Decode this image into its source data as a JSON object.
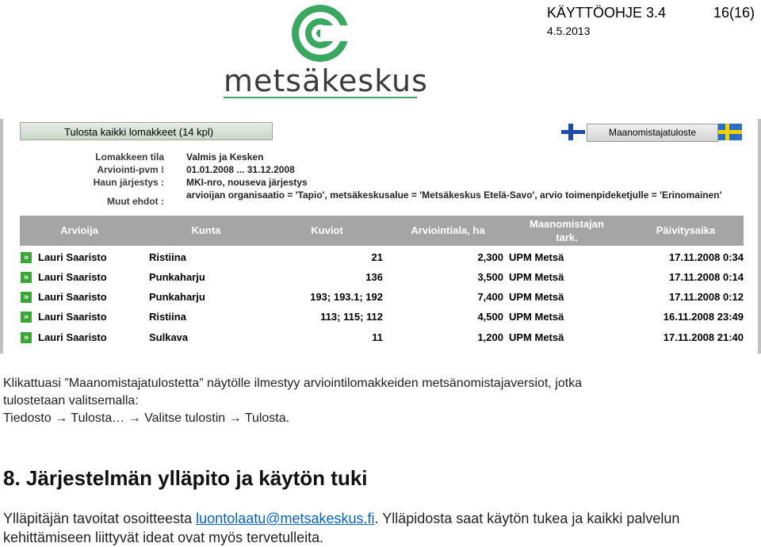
{
  "header": {
    "title": "KÄYTTÖOHJE 3.4",
    "date": "4.5.2013",
    "page": "16(16)"
  },
  "logo": {
    "text": "metsäkeskus",
    "color": "#3aa860"
  },
  "screenshot": {
    "print_all_button": "Tulosta kaikki lomakkeet (14 kpl)",
    "land_owner_button": "Maanomistajatuloste",
    "meta": [
      {
        "label": "Lomakkeen tila :",
        "value": "Valmis ja Kesken"
      },
      {
        "label": "Arviointi-pvm :",
        "value": "01.01.2008 ... 31.12.2008"
      },
      {
        "label": "Haun järjestys :",
        "value": "MKI-nro, nouseva järjestys"
      },
      {
        "label": "Muut ehdot :",
        "value": "arvioijan organisaatio = 'Tapio', metsäkeskusalue = 'Metsäkeskus Etelä-Savo', arvio toimenpideketjulle = 'Erinomainen'"
      }
    ],
    "columns": [
      "Arvioija",
      "Kunta",
      "Kuviot",
      "Arviointiala, ha",
      "Maanomistajan tark.",
      "Päivitysaika"
    ],
    "rows": [
      {
        "arvioija": "Lauri Saaristo",
        "kunta": "Ristiina",
        "kuviot": "21",
        "ala": "2,300",
        "maanomistaja": "UPM Metsä",
        "aika": "17.11.2008 0:34"
      },
      {
        "arvioija": "Lauri Saaristo",
        "kunta": "Punkaharju",
        "kuviot": "136",
        "ala": "3,500",
        "maanomistaja": "UPM Metsä",
        "aika": "17.11.2008 0:14"
      },
      {
        "arvioija": "Lauri Saaristo",
        "kunta": "Punkaharju",
        "kuviot": "193; 193.1; 192",
        "ala": "7,400",
        "maanomistaja": "UPM Metsä",
        "aika": "17.11.2008 0:12"
      },
      {
        "arvioija": "Lauri Saaristo",
        "kunta": "Ristiina",
        "kuviot": "113; 115; 112",
        "ala": "4,500",
        "maanomistaja": "UPM Metsä",
        "aika": "16.11.2008 23:49"
      },
      {
        "arvioija": "Lauri Saaristo",
        "kunta": "Sulkava",
        "kuviot": "11",
        "ala": "1,200",
        "maanomistaja": "UPM Metsä",
        "aika": "17.11.2008 21:40"
      }
    ]
  },
  "caption": {
    "line1": "Klikattuasi ”Maanomistajatulostetta” näytölle ilmestyy arviointilomakkeiden metsänomistajaversiot, jotka",
    "line2": "tulostetaan valitsemalla:",
    "path": [
      "Tiedosto",
      "Tulosta…",
      "Valitse tulostin",
      "Tulosta."
    ]
  },
  "section": {
    "heading": "8. Järjestelmän ylläpito ja käytön tuki",
    "text_before": "Ylläpitäjän tavoitat osoitteesta ",
    "email": "luontolaatu@metsakeskus.fi",
    "text_after": ". Ylläpidosta saat käytön tukea ja kaikki palvelun",
    "line2": "kehittämiseen liittyvät ideat ovat myös tervetulleita."
  }
}
